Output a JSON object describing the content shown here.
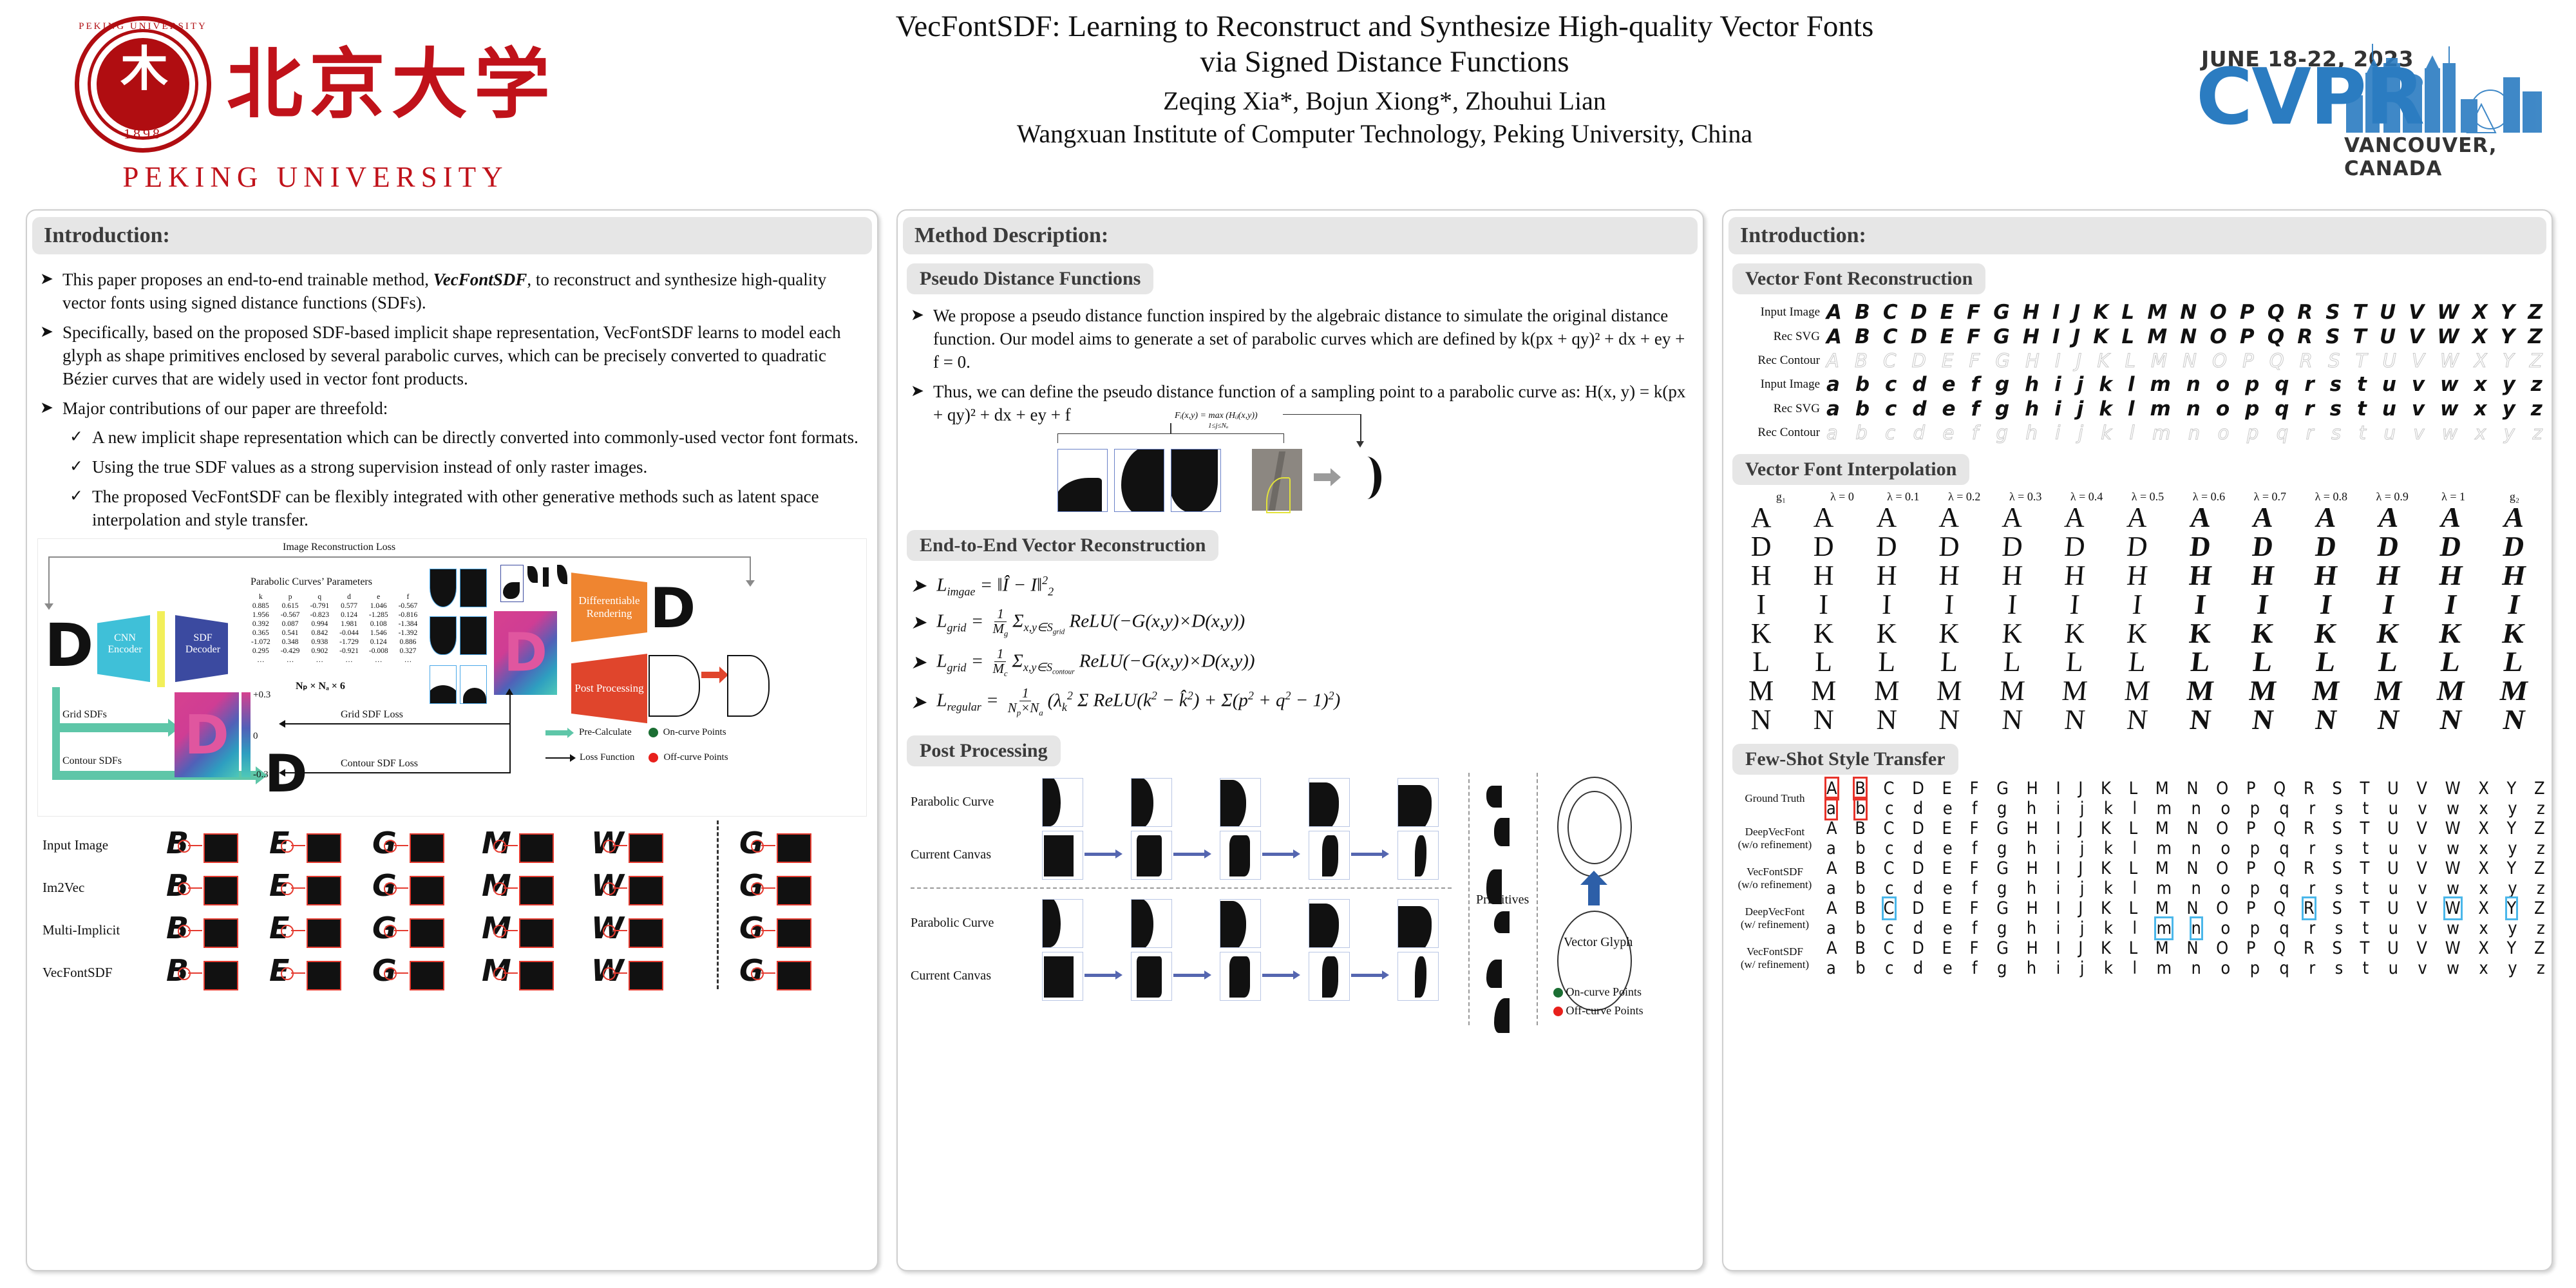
{
  "header": {
    "university_cn": "北京大学",
    "university_en": "PEKING UNIVERSITY",
    "seal_arc": "PEKING UNIVERSITY",
    "seal_year": "1898",
    "title_line1": "VecFontSDF: Learning to Reconstruct and Synthesize High-quality Vector Fonts",
    "title_line2": "via Signed Distance Functions",
    "authors": "Zeqing Xia*, Bojun Xiong*, Zhouhui Lian",
    "affiliation": "Wangxuan Institute of Computer Technology, Peking University, China",
    "cvpr_date": "JUNE 18-22, 2023",
    "cvpr_name": "CVPR",
    "cvpr_city": "VANCOUVER, CANADA",
    "brand_red": "#c0121a",
    "brand_blue": "#2b7cc1"
  },
  "left": {
    "heading": "Introduction:",
    "bullets": [
      {
        "marker": "➤",
        "text_a": "This paper proposes an end-to-end trainable method, ",
        "em": "VecFontSDF",
        "text_b": ", to reconstruct and synthesize high-quality vector fonts using signed distance functions (SDFs)."
      },
      {
        "marker": "➤",
        "text_a": "Specifically, based on the proposed SDF-based implicit shape representation, VecFontSDF learns to model each glyph as shape primitives enclosed by several parabolic curves, which can be precisely converted to quadratic Bézier curves that are widely used in vector font products.",
        "em": "",
        "text_b": ""
      },
      {
        "marker": "➤",
        "text_a": "Major contributions of our paper are threefold:",
        "em": "",
        "text_b": ""
      }
    ],
    "subbullets": [
      {
        "marker": "✓",
        "text": "A new implicit shape representation which can be directly converted into commonly-used vector font formats."
      },
      {
        "marker": "✓",
        "text": "Using the true SDF values as a strong supervision instead of only raster images."
      },
      {
        "marker": "✓",
        "text": "The proposed VecFontSDF can be flexibly integrated with other generative methods such as latent space interpolation and style transfer."
      }
    ],
    "architecture": {
      "image_recon_loss": "Image Reconstruction Loss",
      "params_title": "Parabolic Curves’ Parameters",
      "param_headers": [
        "k",
        "p",
        "q",
        "d",
        "e",
        "f"
      ],
      "param_rows": [
        [
          "0.885",
          "0.615",
          "-0.791",
          "0.577",
          "1.046",
          "-0.567"
        ],
        [
          "1.956",
          "-0.567",
          "-0.823",
          "0.124",
          "-1.285",
          "-0.816"
        ],
        [
          "0.392",
          "0.087",
          "0.994",
          "1.981",
          "0.108",
          "-1.384"
        ],
        [
          "0.365",
          "0.541",
          "0.842",
          "-0.044",
          "1.546",
          "-1.392"
        ],
        [
          "-1.072",
          "0.348",
          "0.938",
          "-1.729",
          "0.124",
          "0.886"
        ],
        [
          "0.295",
          "-0.429",
          "0.902",
          "-0.921",
          "-0.008",
          "0.327"
        ],
        [
          "…",
          "…",
          "…",
          "…",
          "…",
          "…"
        ]
      ],
      "dims": "Nₚ × Nₐ × 6",
      "cnn_encoder": "CNN Encoder",
      "sdf_decoder": "SDF Decoder",
      "diff_render": "Differentiable Rendering",
      "post_proc": "Post Processing",
      "grid_sdfs": "Grid SDFs",
      "contour_sdfs": "Contour SDFs",
      "grid_sdf_loss": "Grid SDF Loss",
      "contour_sdf_loss": "Contour SDF Loss",
      "scale_top": "+0.3",
      "scale_mid": "0",
      "scale_bot": "-0.3",
      "glyph": "D",
      "legend": [
        {
          "label": "Pre-Calculate",
          "type": "arrow",
          "color": "#5ec6a8"
        },
        {
          "label": "On-curve Points",
          "type": "dot",
          "color": "#1b6e33"
        },
        {
          "label": "Loss Function",
          "type": "arrow",
          "color": "#111111"
        },
        {
          "label": "Off-curve Points",
          "type": "dot",
          "color": "#e8201c"
        }
      ]
    },
    "comparison": {
      "row_labels": [
        "Input Image",
        "Im2Vec",
        "Multi-Implicit",
        "VecFontSDF"
      ],
      "glyphs": [
        "B",
        "E",
        "G",
        "M",
        "W",
        "G"
      ]
    }
  },
  "mid": {
    "heading": "Method Description:",
    "sub1": "Pseudo Distance Functions",
    "bullets1": [
      "We propose a pseudo distance function inspired by the algebraic distance to simulate the original distance function. Our model aims to generate a set of parabolic curves which are defined by k(px + qy)² + dx + ey + f = 0.",
      "Thus, we can define the pseudo distance function of a sampling point to a parabolic curve as: H(x, y) = k(px + qy)² + dx + ey + f"
    ],
    "fig_formula": "Fᵢ(x,y) = max (Hᵢⱼ(x,y))",
    "fig_formula_sub": "1≤j≤Nₐ",
    "sub2": "End-to-End Vector Reconstruction",
    "equations": [
      {
        "lhs": "L",
        "sub": "imgae",
        "rhs": "= ‖Î − I‖²₂"
      },
      {
        "lhs": "L",
        "sub": "grid",
        "rhs": "= (1/M_g) Σ x,y∈S_grid ReLU(−G(x,y)×D(x,y))"
      },
      {
        "lhs": "L",
        "sub": "grid",
        "rhs": "= (1/M_c) Σ x,y∈S_contour ReLU(−G(x,y)×D(x,y))"
      },
      {
        "lhs": "L",
        "sub": "regular",
        "rhs": "= (1/(N_p×N_a)) (λ_k² Σ ReLU(k² − k̂²) + Σ(p² + q² − 1)²)"
      }
    ],
    "sub3": "Post Processing",
    "postfig": {
      "row_labels": [
        "Parabolic Curve",
        "Current Canvas",
        "Parabolic Curve",
        "Current Canvas"
      ],
      "primitives": "Primitives",
      "vector_glyph": "Vector Glyph",
      "legend": [
        {
          "label": "On-curve Points",
          "color": "#1b6e33"
        },
        {
          "label": "Off-curve Points",
          "color": "#e8201c"
        }
      ]
    }
  },
  "right": {
    "heading": "Introduction:",
    "sub1": "Vector Font Reconstruction",
    "recon_rows": [
      {
        "label": "Input Image",
        "case": "upper",
        "style": "bold-it"
      },
      {
        "label": "Rec SVG",
        "case": "upper",
        "style": "bold-it"
      },
      {
        "label": "Rec Contour",
        "case": "upper",
        "style": "outline"
      },
      {
        "label": "Input Image",
        "case": "lower",
        "style": "bold-it"
      },
      {
        "label": "Rec SVG",
        "case": "lower",
        "style": "bold-it"
      },
      {
        "label": "Rec Contour",
        "case": "lower",
        "style": "outline"
      }
    ],
    "alphabet_upper": [
      "A",
      "B",
      "C",
      "D",
      "E",
      "F",
      "G",
      "H",
      "I",
      "J",
      "K",
      "L",
      "M",
      "N",
      "O",
      "P",
      "Q",
      "R",
      "S",
      "T",
      "U",
      "V",
      "W",
      "X",
      "Y",
      "Z"
    ],
    "alphabet_lower": [
      "a",
      "b",
      "c",
      "d",
      "e",
      "f",
      "g",
      "h",
      "i",
      "j",
      "k",
      "l",
      "m",
      "n",
      "o",
      "p",
      "q",
      "r",
      "s",
      "t",
      "u",
      "v",
      "w",
      "x",
      "y",
      "z"
    ],
    "sub2": "Vector Font Interpolation",
    "interp_headers": [
      "g₁",
      "λ = 0",
      "λ = 0.1",
      "λ = 0.2",
      "λ = 0.3",
      "λ = 0.4",
      "λ = 0.5",
      "λ = 0.6",
      "λ = 0.7",
      "λ = 0.8",
      "λ = 0.9",
      "λ = 1",
      "g₂"
    ],
    "interp_letters": [
      "A",
      "D",
      "H",
      "I",
      "K",
      "L",
      "M",
      "N"
    ],
    "interp_columns": 13,
    "sub3": "Few-Shot Style Transfer",
    "fewshot_rows": [
      {
        "label_line1": "Ground Truth",
        "label_line2": "",
        "highlight": "red",
        "highlight_cols_upper": [
          0,
          1
        ],
        "highlight_cols_lower": [
          0,
          1
        ]
      },
      {
        "label_line1": "DeepVecFont",
        "label_line2": "(w/o refinement)",
        "highlight": "none",
        "highlight_cols_upper": [],
        "highlight_cols_lower": []
      },
      {
        "label_line1": "VecFontSDF",
        "label_line2": "(w/o refinement)",
        "highlight": "none",
        "highlight_cols_upper": [],
        "highlight_cols_lower": []
      },
      {
        "label_line1": "DeepVecFont",
        "label_line2": "(w/ refinement)",
        "highlight": "blue",
        "highlight_cols_upper": [
          2,
          17,
          22,
          24
        ],
        "highlight_cols_lower": [
          12,
          13
        ]
      },
      {
        "label_line1": "VecFontSDF",
        "label_line2": "(w/ refinement)",
        "highlight": "none",
        "highlight_cols_upper": [],
        "highlight_cols_lower": []
      }
    ]
  }
}
